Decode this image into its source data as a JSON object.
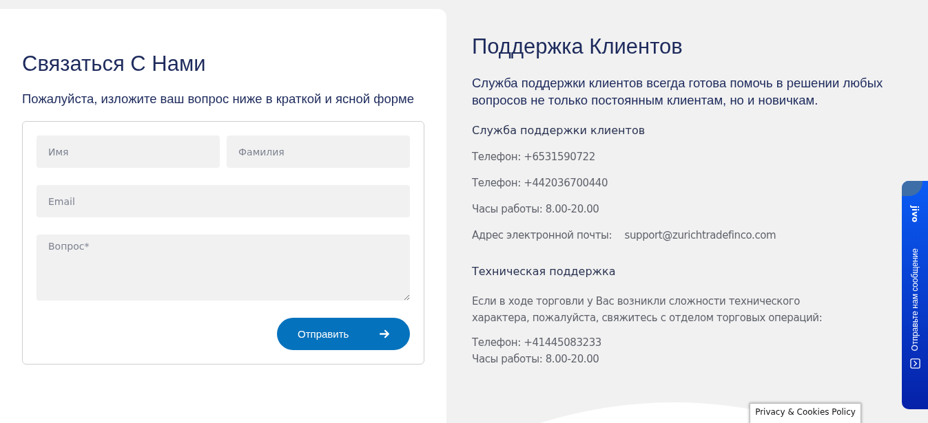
{
  "contact_form": {
    "title": "Связаться С Нами",
    "subtitle": "Пожалуйста, изложите ваш вопрос ниже в краткой и ясной форме",
    "fields": [
      {
        "kind": "half",
        "placeholder": "Имя"
      },
      {
        "kind": "half",
        "placeholder": "Фамилия"
      },
      {
        "kind": "full",
        "placeholder": "Email"
      },
      {
        "kind": "textarea",
        "placeholder": "Вопрос*"
      }
    ],
    "submit": "Отправить"
  },
  "support": {
    "title": "Поддержка Клиентов",
    "intro": "Служба поддержки клиентов всегда готова помочь в решении любых вопросов не только постоянным клиентам, но и новичкам.",
    "sections": [
      {
        "heading": "Служба поддержки клиентов",
        "lines": [
          {
            "label": "Телефон:",
            "value": "+6531590722"
          },
          {
            "label": "Телефон:",
            "value": "+442036700440"
          },
          {
            "label": "Часы работы:",
            "value": "8.00-20.00"
          },
          {
            "label": "Адрес электронной почты:",
            "value": "support@zurichtradefinco.com"
          }
        ]
      },
      {
        "heading": "Техническая поддержка",
        "text": "Если в ходе торговли у Вас возникли сложности технического характера, пожалуйста, свяжитесь с отделом торговых операций:",
        "lines": [
          {
            "label": "Телефон:",
            "value": "+41445083233"
          },
          {
            "label": "Часы работы:",
            "value": "8.00-20.00"
          }
        ]
      }
    ]
  },
  "chat_tab": {
    "brand": "jivo",
    "label": "Отправьте нам сообщение"
  },
  "cookie_button": "Privacy & Cookies Policy"
}
